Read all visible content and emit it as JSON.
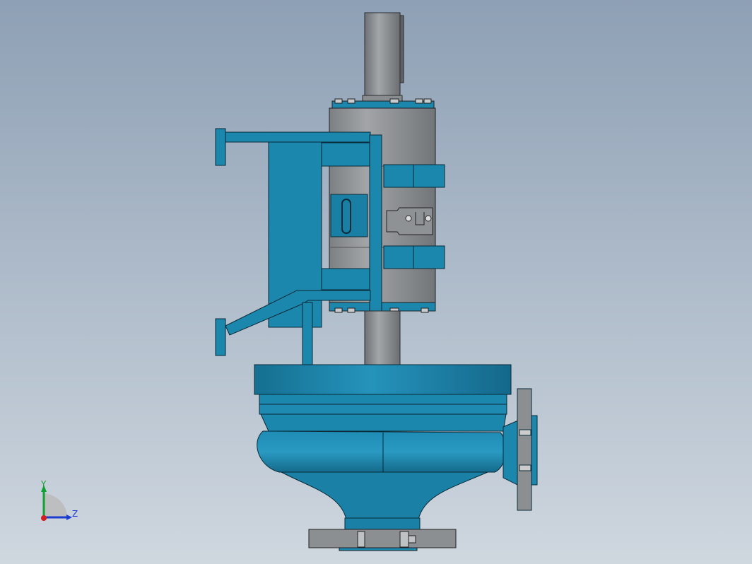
{
  "viewport": {
    "background_top": "#8ea0b5",
    "background_bottom": "#cfd7df"
  },
  "model": {
    "primary_color": "#1c87ad",
    "secondary_color": "#8c8f92",
    "edge_color": "#0a2a38"
  },
  "triad": {
    "y_label": "Y",
    "z_label": "Z",
    "y_color": "#11a032",
    "z_color": "#1b3bd1",
    "x_color": "#d02020"
  }
}
